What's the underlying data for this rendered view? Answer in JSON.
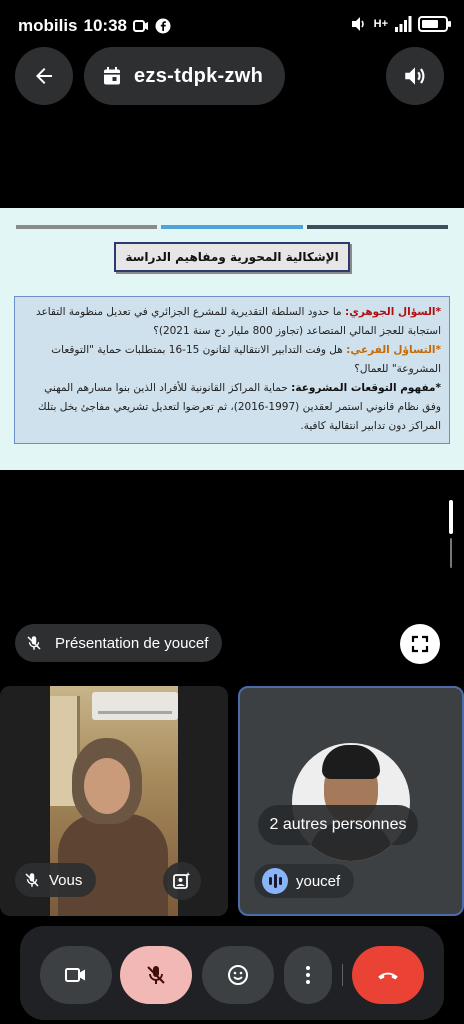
{
  "status_bar": {
    "carrier": "mobilis",
    "time": "10:38",
    "network": "H+",
    "battery_level": 0.6
  },
  "top_bar": {
    "meeting_code": "ezs-tdpk-zwh",
    "back_icon": "arrow-left-icon",
    "calendar_icon": "calendar-icon",
    "audio_icon": "speaker-icon"
  },
  "slide": {
    "title": "الإشكالية المحورية ومفاهيم الدراسة",
    "q1_label": "*السؤال الجوهري:",
    "q1_text": "ما حدود السلطة التقديرية للمشرع الجزائري في تعديل منظومة التقاعد استجابة للعجز المالي المتصاعد (تجاوز 800 مليار دج سنة 2021)؟",
    "q2_label": "*التساؤل الفرعي:",
    "q2_text": "هل وفت التدابير الانتقالية لقانون 15-16 بمتطلبات حماية \"التوقعات المشروعة\" للعمال؟",
    "q3_label": "*مفهوم التوقعات المشروعة:",
    "q3_text": "حماية المراكز القانونية للأفراد الذين بنوا مسارهم المهني وفق نظام قانوني استمر لعقدين (1997-2016)، ثم تعرضوا لتعديل تشريعي مفاجئ يخل بتلك المراكز دون تدابير انتقالية كافية.",
    "colors": {
      "bg": "#e3f6f6",
      "line1": "#8a8a8a",
      "line2": "#4fa3d9",
      "line3": "#3d4f5c"
    }
  },
  "presentation": {
    "label": "Présentation de youcef"
  },
  "tiles": {
    "self_label": "Vous",
    "others_label": "2 autres personnes",
    "speaker_label": "youcef"
  },
  "controls": {
    "camera_icon": "video-camera-icon",
    "mic_icon": "mic-off-icon",
    "reactions_icon": "emoji-icon",
    "more_icon": "more-vert-icon",
    "end_icon": "call-end-icon",
    "end_color": "#ea4335",
    "mic_color": "#f2b8b5"
  }
}
